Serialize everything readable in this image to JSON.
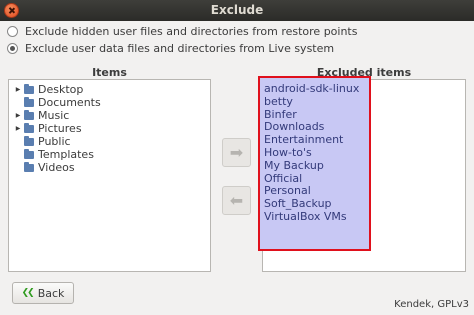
{
  "window": {
    "title": "Exclude"
  },
  "options": [
    {
      "label": "Exclude hidden user files and directories from restore points",
      "checked": false
    },
    {
      "label": "Exclude user data files and directories from Live system",
      "checked": true
    }
  ],
  "items_panel": {
    "header": "Items",
    "rows": [
      {
        "label": "Desktop",
        "expandable": true
      },
      {
        "label": "Documents",
        "expandable": false
      },
      {
        "label": "Music",
        "expandable": true
      },
      {
        "label": "Pictures",
        "expandable": true
      },
      {
        "label": "Public",
        "expandable": false
      },
      {
        "label": "Templates",
        "expandable": false
      },
      {
        "label": "Videos",
        "expandable": false
      }
    ]
  },
  "buttons": {
    "add_icon": "right-arrow-icon",
    "remove_icon": "left-arrow-icon",
    "add_glyph": "➡",
    "remove_glyph": "⬅",
    "back_label": "Back",
    "back_icon": "double-chevron-left-icon",
    "back_glyph": "❮❮"
  },
  "excluded_panel": {
    "header": "Excluded items",
    "items": [
      "android-sdk-linux",
      "betty",
      "Binfer",
      "Downloads",
      "Entertainment",
      "How-to's",
      "My Backup",
      "Official",
      "Personal",
      "Soft_Backup",
      "VirtualBox VMs"
    ]
  },
  "footer": {
    "text": "Kendek, GPLv3"
  },
  "colors": {
    "highlight": "#c8c8f4",
    "highlight_border": "#e0101c",
    "folder": "#5a7eb0"
  }
}
